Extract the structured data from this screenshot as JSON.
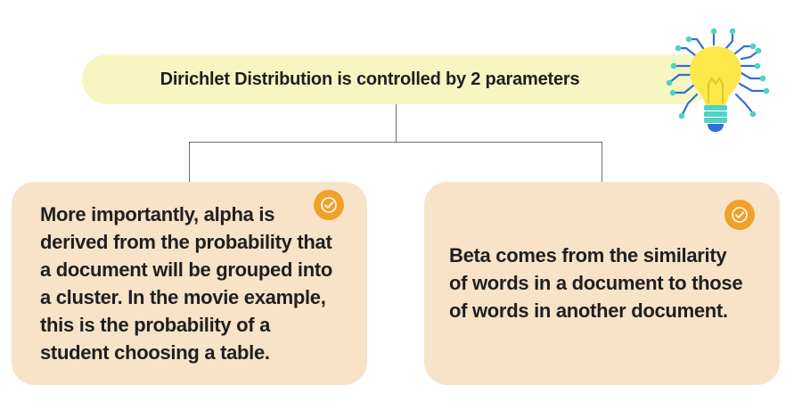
{
  "header": {
    "title": "Dirichlet Distribution is controlled by 2 parameters"
  },
  "cards": [
    {
      "text": "More importantly, alpha is\nderived from the probability that\na document will be grouped into\na cluster. In the movie example,\nthis is the probability of a\nstudent choosing a table.",
      "badge_icon": "check-icon"
    },
    {
      "text": " Beta comes from the similarity\nof words in a document to those\nof words in another document.",
      "badge_icon": "check-icon"
    }
  ],
  "decoration": {
    "icon": "lightbulb-circuit-icon",
    "colors": {
      "bulb": "#fbe84a",
      "bulb_base": "#4fd3c4",
      "bulb_bottom": "#2f6fd6",
      "circuit": "#2f6fd6",
      "circuit_dots": "#4fd3c4"
    }
  },
  "colors": {
    "header_bg": "#f7f5c2",
    "card_bg": "#f8e3c8",
    "badge": "#efa12a",
    "connector": "#6e6e6e"
  }
}
